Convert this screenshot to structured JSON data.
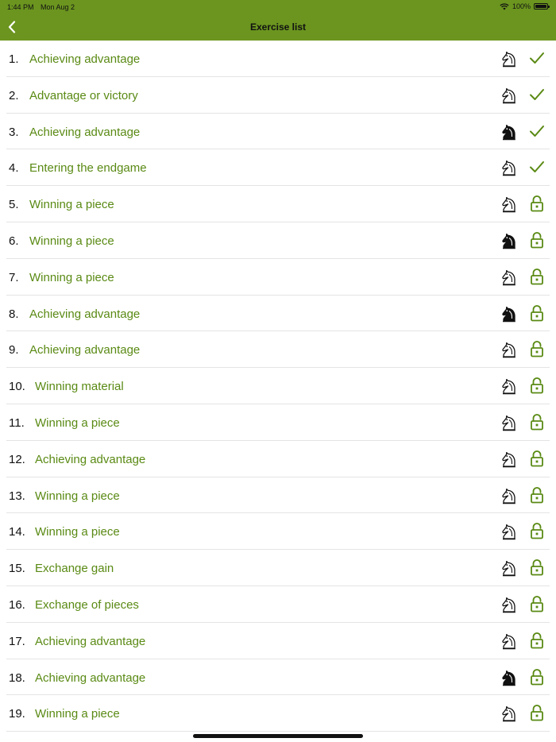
{
  "status_bar": {
    "time": "1:44 PM",
    "date": "Mon Aug 2",
    "battery": "100%"
  },
  "nav": {
    "title": "Exercise list"
  },
  "colors": {
    "accent": "#6b951f",
    "title_text": "#5a8a14"
  },
  "exercises": [
    {
      "number": "1.",
      "title": "Achieving advantage",
      "knight": "white",
      "status": "done"
    },
    {
      "number": "2.",
      "title": "Advantage or victory",
      "knight": "white",
      "status": "done"
    },
    {
      "number": "3.",
      "title": "Achieving advantage",
      "knight": "black",
      "status": "done"
    },
    {
      "number": "4.",
      "title": "Entering the endgame",
      "knight": "white",
      "status": "done"
    },
    {
      "number": "5.",
      "title": "Winning a piece",
      "knight": "white",
      "status": "unlocked"
    },
    {
      "number": "6.",
      "title": "Winning a piece",
      "knight": "black",
      "status": "unlocked"
    },
    {
      "number": "7.",
      "title": "Winning a piece",
      "knight": "white",
      "status": "unlocked"
    },
    {
      "number": "8.",
      "title": "Achieving advantage",
      "knight": "black",
      "status": "unlocked"
    },
    {
      "number": "9.",
      "title": "Achieving advantage",
      "knight": "white",
      "status": "unlocked"
    },
    {
      "number": "10.",
      "title": "Winning material",
      "knight": "white",
      "status": "unlocked"
    },
    {
      "number": "11.",
      "title": "Winning a piece",
      "knight": "white",
      "status": "unlocked"
    },
    {
      "number": "12.",
      "title": "Achieving advantage",
      "knight": "white",
      "status": "unlocked"
    },
    {
      "number": "13.",
      "title": "Winning a piece",
      "knight": "white",
      "status": "unlocked"
    },
    {
      "number": "14.",
      "title": "Winning a piece",
      "knight": "white",
      "status": "unlocked"
    },
    {
      "number": "15.",
      "title": "Exchange gain",
      "knight": "white",
      "status": "unlocked"
    },
    {
      "number": "16.",
      "title": "Exchange of pieces",
      "knight": "white",
      "status": "unlocked"
    },
    {
      "number": "17.",
      "title": "Achieving advantage",
      "knight": "white",
      "status": "unlocked"
    },
    {
      "number": "18.",
      "title": "Achieving advantage",
      "knight": "black",
      "status": "unlocked"
    },
    {
      "number": "19.",
      "title": "Winning a piece",
      "knight": "white",
      "status": "unlocked"
    }
  ]
}
